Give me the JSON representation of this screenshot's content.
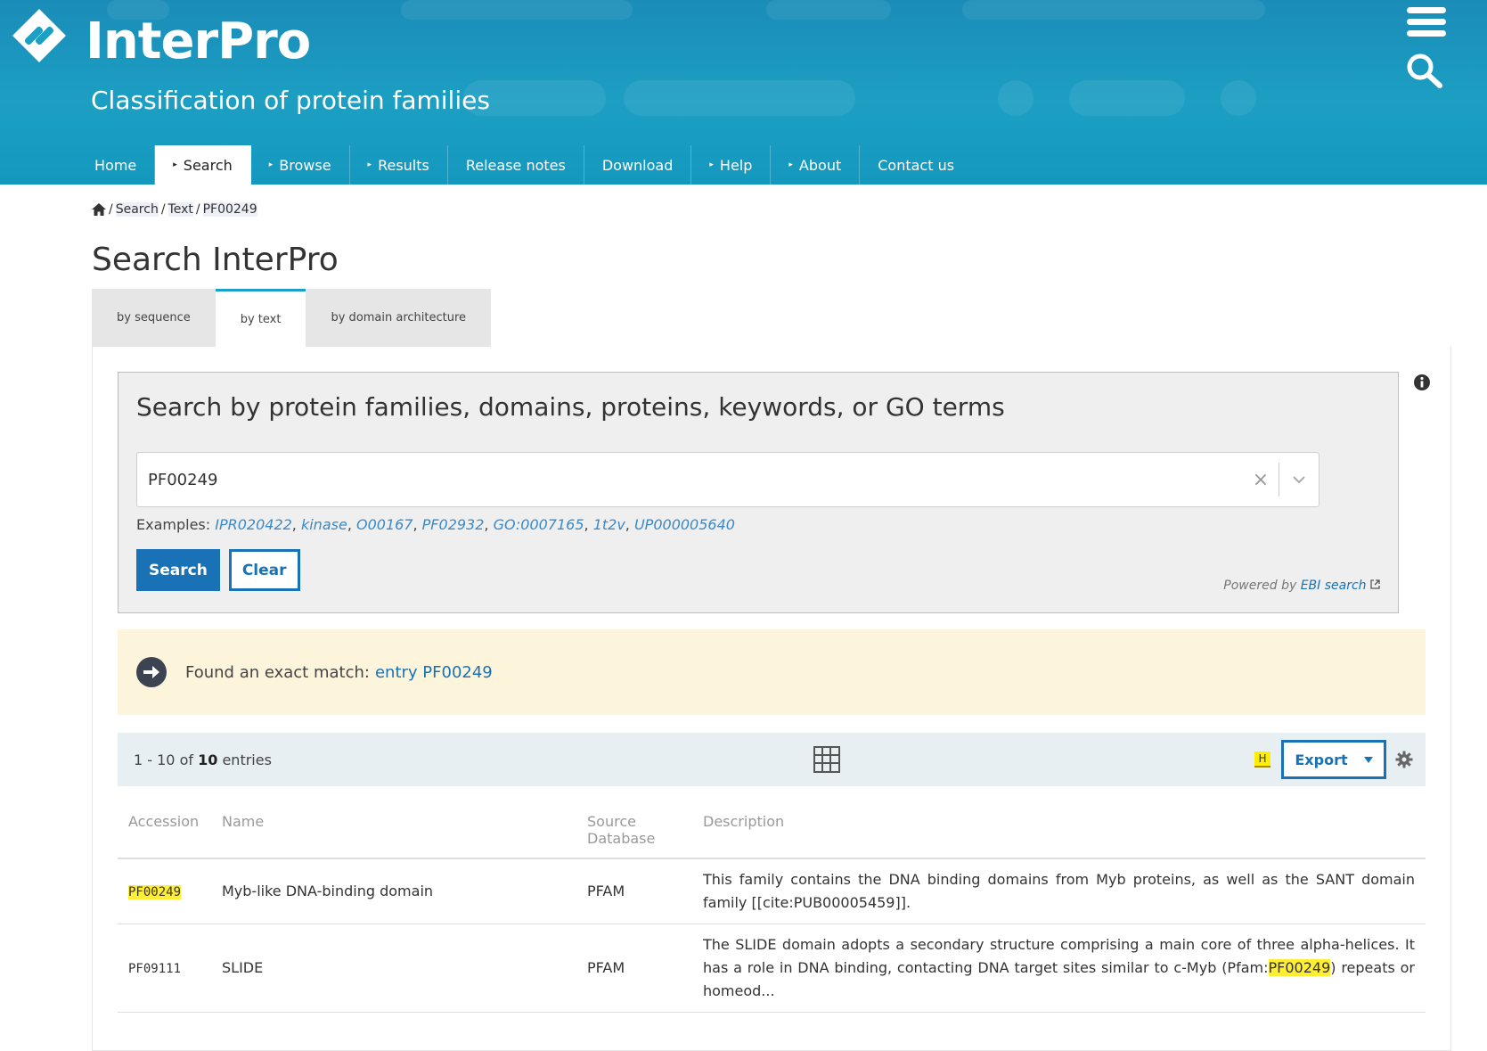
{
  "site": {
    "title": "InterPro",
    "subtitle": "Classification of protein families"
  },
  "nav": [
    {
      "label": "Home",
      "arrow": false,
      "active": false
    },
    {
      "label": "Search",
      "arrow": true,
      "active": true
    },
    {
      "label": "Browse",
      "arrow": true,
      "active": false
    },
    {
      "label": "Results",
      "arrow": true,
      "active": false
    },
    {
      "label": "Release notes",
      "arrow": false,
      "active": false
    },
    {
      "label": "Download",
      "arrow": false,
      "active": false
    },
    {
      "label": "Help",
      "arrow": true,
      "active": false
    },
    {
      "label": "About",
      "arrow": true,
      "active": false
    },
    {
      "label": "Contact us",
      "arrow": false,
      "active": false
    }
  ],
  "breadcrumb": [
    "Search",
    "Text",
    "PF00249"
  ],
  "page_title": "Search InterPro",
  "tabs": [
    {
      "label": "by sequence",
      "active": false
    },
    {
      "label": "by text",
      "active": true
    },
    {
      "label": "by domain architecture",
      "active": false
    }
  ],
  "search": {
    "heading": "Search by protein families, domains, proteins, keywords, or GO terms",
    "value": "PF00249",
    "examples_label": "Examples:",
    "examples": [
      "IPR020422",
      "kinase",
      "O00167",
      "PF02932",
      "GO:0007165",
      "1t2v",
      "UP000005640"
    ],
    "search_button": "Search",
    "clear_button": "Clear",
    "powered_prefix": "Powered by",
    "powered_link": "EBI search"
  },
  "exact_match": {
    "text": "Found an exact match:",
    "link": "entry PF00249"
  },
  "results_bar": {
    "range": "1 - 10 of",
    "total": "10",
    "suffix": "entries",
    "highlight_badge": "H",
    "export_label": "Export"
  },
  "table": {
    "headers": [
      "Accession",
      "Name",
      "Source Database",
      "Description"
    ],
    "rows": [
      {
        "accession": "PF00249",
        "name": "Myb-like DNA-binding domain",
        "source": "PFAM",
        "description_pre": "This family contains the DNA binding domains from Myb proteins, as well as the SANT domain family [[cite:PUB00005459]].",
        "description_hl": "",
        "description_post": ""
      },
      {
        "accession": "PF09111",
        "name": "SLIDE",
        "source": "PFAM",
        "description_pre": "The SLIDE domain adopts a secondary structure comprising a main core of three alpha-helices. It has a role in DNA binding, contacting DNA target sites similar to c-Myb (Pfam:",
        "description_hl": "PF00249",
        "description_post": ") repeats or homeod..."
      }
    ]
  },
  "colors": {
    "header_bg": "#1c9fc3",
    "accent_blue": "#1a72b6",
    "highlight_yellow": "#ffee33",
    "exact_match_bg": "#fdf4dc"
  }
}
